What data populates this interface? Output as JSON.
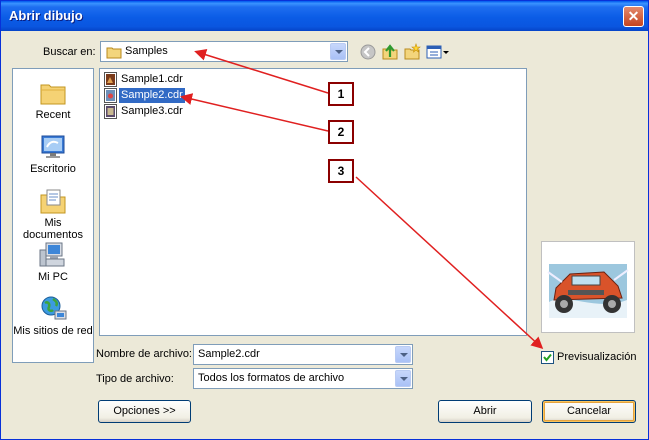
{
  "window": {
    "title": "Abrir dibujo",
    "close_glyph": "✕"
  },
  "lookin": {
    "label": "Buscar en:",
    "value": "Samples"
  },
  "places": [
    {
      "label": "Recent",
      "icon": "recent-folder-icon"
    },
    {
      "label": "Escritorio",
      "icon": "desktop-icon"
    },
    {
      "label": "Mis documentos",
      "icon": "my-documents-icon"
    },
    {
      "label": "Mi PC",
      "icon": "my-computer-icon"
    },
    {
      "label": "Mis sitios de red",
      "icon": "network-places-icon"
    }
  ],
  "files": [
    {
      "name": "Sample1.cdr",
      "selected": false
    },
    {
      "name": "Sample2.cdr",
      "selected": true
    },
    {
      "name": "Sample3.cdr",
      "selected": false
    }
  ],
  "filename": {
    "label": "Nombre de archivo:",
    "value": "Sample2.cdr"
  },
  "filetype": {
    "label": "Tipo de archivo:",
    "value": "Todos los formatos de archivo"
  },
  "preview": {
    "checkbox_label": "Previsualización",
    "checked": true
  },
  "buttons": {
    "options": "Opciones >>",
    "open": "Abrir",
    "cancel": "Cancelar"
  },
  "callouts": [
    "1",
    "2",
    "3"
  ],
  "colors": {
    "titlebar": "#0a56e0",
    "selection": "#316ac5",
    "callout_arrow": "#e02020"
  }
}
